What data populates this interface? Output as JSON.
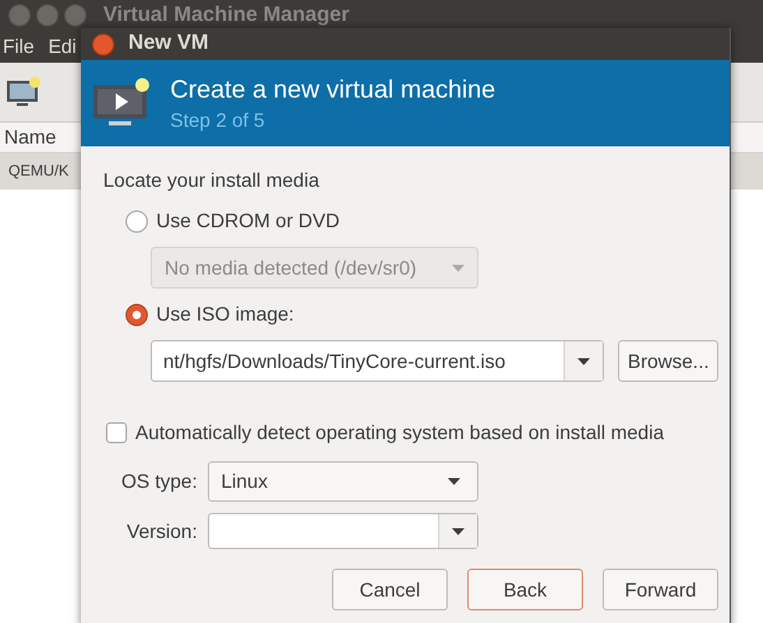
{
  "main_window": {
    "title": "Virtual Machine Manager",
    "menu": [
      "File",
      "Edi"
    ],
    "column_header": "Name",
    "rows": [
      "QEMU/K"
    ]
  },
  "dialog": {
    "title": "New VM",
    "heading": "Create a new virtual machine",
    "step": "Step 2 of 5",
    "section_label": "Locate your install media",
    "media_options": [
      {
        "label": "Use CDROM or DVD",
        "selected": false
      },
      {
        "label": "Use ISO image:",
        "selected": true
      }
    ],
    "cdrom_select": {
      "value": "No media detected (/dev/sr0)",
      "disabled": true
    },
    "iso_path": {
      "value": "nt/hgfs/Downloads/TinyCore-current.iso"
    },
    "browse_button": "Browse...",
    "auto_detect": {
      "label": "Automatically detect operating system based on install media",
      "checked": false
    },
    "os_type": {
      "label": "OS type:",
      "value": "Linux"
    },
    "version": {
      "label": "Version:"
    },
    "buttons": [
      {
        "label": "Cancel",
        "default": false
      },
      {
        "label": "Back",
        "default": true
      },
      {
        "label": "Forward",
        "default": false
      }
    ]
  }
}
